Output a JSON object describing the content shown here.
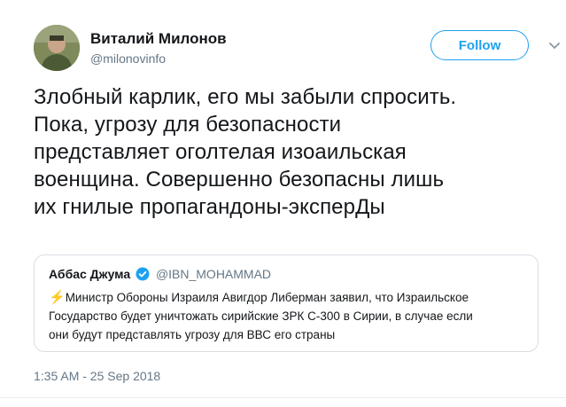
{
  "user": {
    "name": "Виталий Милонов",
    "handle": "@milonovinfo",
    "follow_label": "Follow"
  },
  "tweet": {
    "lines": [
      "Злобный карлик, его мы забыли спросить.",
      "Пока, угрозу для безопасности",
      "представляет оголтелая изоаильская",
      "военщина. Совершенно безопасны лишь",
      "их гнилые пропагандоны-эксперДы"
    ],
    "timestamp": "1:35 AM - 25 Sep 2018"
  },
  "quoted": {
    "name": "Аббас Джума",
    "handle": "@IBN_MOHAMMAD",
    "bolt": "⚡",
    "lines": [
      "Министр Обороны Израиля Авигдор Либерман заявил, что Израильское",
      "Государство будет уничтожать сирийские ЗРК С-300 в Сирии, в случае если",
      "они будут представлять угрозу для ВВС его страны"
    ]
  },
  "colors": {
    "accent": "#1da1f2",
    "secondary_text": "#657786",
    "border": "#d9dee3"
  },
  "icons": {
    "verified": "verified-badge-icon",
    "caret": "chevron-down-icon",
    "bolt": "lightning-emoji"
  }
}
